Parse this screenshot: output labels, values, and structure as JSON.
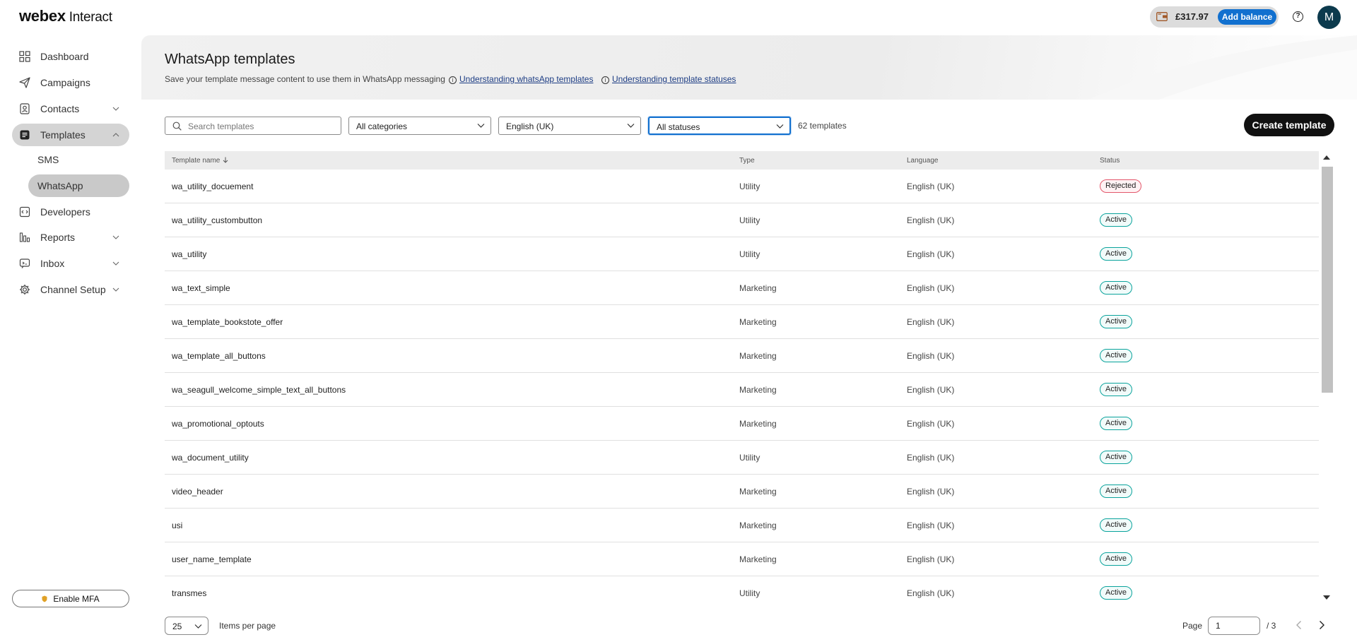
{
  "brand": {
    "logo_bold": "webex",
    "logo_light": "Interact"
  },
  "topbar": {
    "balance": "£317.97",
    "add_balance_label": "Add balance",
    "avatar_initial": "M",
    "help_glyph": "?"
  },
  "sidebar": {
    "items": [
      {
        "label": "Dashboard",
        "icon": "dashboard-icon"
      },
      {
        "label": "Campaigns",
        "icon": "paper-plane-icon"
      },
      {
        "label": "Contacts",
        "icon": "contacts-icon"
      },
      {
        "label": "Templates",
        "icon": "templates-icon",
        "active": true
      },
      {
        "label": "Developers",
        "icon": "code-icon"
      },
      {
        "label": "Reports",
        "icon": "bar-chart-icon"
      },
      {
        "label": "Inbox",
        "icon": "inbox-icon"
      },
      {
        "label": "Channel Setup",
        "icon": "gear-icon"
      }
    ],
    "sub_items": [
      {
        "label": "SMS"
      },
      {
        "label": "WhatsApp",
        "active": true
      }
    ],
    "mfa_label": "Enable MFA"
  },
  "header": {
    "title": "WhatsApp templates",
    "subtitle": "Save your template message content to use them in WhatsApp messaging",
    "link1": "Understanding whatsApp templates",
    "link2": "Understanding template statuses",
    "info_glyph": "i"
  },
  "filters": {
    "search_placeholder": "Search templates",
    "category": "All categories",
    "language": "English (UK)",
    "status": "All statuses",
    "count": "62 templates",
    "create_label": "Create template"
  },
  "table": {
    "columns": {
      "name": "Template name",
      "type": "Type",
      "language": "Language",
      "status": "Status"
    },
    "rows": [
      {
        "name": "wa_utility_docuement",
        "type": "Utility",
        "language": "English (UK)",
        "status": "Rejected"
      },
      {
        "name": "wa_utility_custombutton",
        "type": "Utility",
        "language": "English (UK)",
        "status": "Active"
      },
      {
        "name": "wa_utility",
        "type": "Utility",
        "language": "English (UK)",
        "status": "Active"
      },
      {
        "name": "wa_text_simple",
        "type": "Marketing",
        "language": "English (UK)",
        "status": "Active"
      },
      {
        "name": "wa_template_bookstote_offer",
        "type": "Marketing",
        "language": "English (UK)",
        "status": "Active"
      },
      {
        "name": "wa_template_all_buttons",
        "type": "Marketing",
        "language": "English (UK)",
        "status": "Active"
      },
      {
        "name": "wa_seagull_welcome_simple_text_all_buttons",
        "type": "Marketing",
        "language": "English (UK)",
        "status": "Active"
      },
      {
        "name": "wa_promotional_optouts",
        "type": "Marketing",
        "language": "English (UK)",
        "status": "Active"
      },
      {
        "name": "wa_document_utility",
        "type": "Utility",
        "language": "English (UK)",
        "status": "Active"
      },
      {
        "name": "video_header",
        "type": "Marketing",
        "language": "English (UK)",
        "status": "Active"
      },
      {
        "name": "usi",
        "type": "Marketing",
        "language": "English (UK)",
        "status": "Active"
      },
      {
        "name": "user_name_template",
        "type": "Marketing",
        "language": "English (UK)",
        "status": "Active"
      },
      {
        "name": "transmes",
        "type": "Utility",
        "language": "English (UK)",
        "status": "Active"
      }
    ]
  },
  "pagination": {
    "per_page": "25",
    "per_page_label": "Items per page",
    "page_label": "Page",
    "current_page": "1",
    "total_pages": "/ 3"
  },
  "colors": {
    "accent": "#1170cf",
    "active_badge": "#0aa39c",
    "rejected_badge": "#e3576b",
    "primary_button": "#111111"
  }
}
